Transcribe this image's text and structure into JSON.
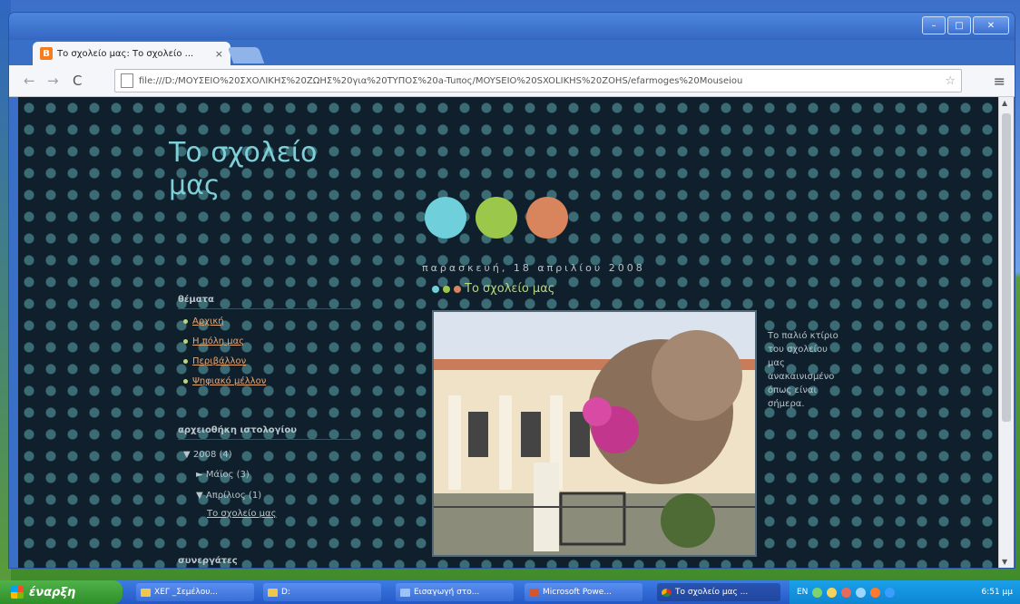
{
  "browser": {
    "tab_title": "Το σχολείο μας: Το σχολείο ...",
    "tab_favicon": "B",
    "tab_close": "×",
    "url": "file:///D:/ΜΟΥΣΕΙΟ%20ΣΧΟΛΙΚΗΣ%20ΖΩΗΣ%20για%20ΤΥΠΟΣ%20a-Tuπος/MOYSEIO%20SXOLIKHS%20ZOHS/efarmoges%20Mouseiou"
  },
  "blog": {
    "title": "Το σχολείο μας",
    "date": "παρασκευή, 18 απριλίου 2008",
    "post_title": "Το σχολείο μας",
    "post_text": "Το παλιό κτίριο του σχολείου μας ανακαινισμένο όπως είναι σήμερα.",
    "colors": {
      "teal": "#6fd0dc",
      "green": "#9bc84a",
      "orange": "#d8845c"
    }
  },
  "sidebar": {
    "nav_heading": "θέματα",
    "nav_items": [
      {
        "label": "Αρχική"
      },
      {
        "label": "Η πόλη μας"
      },
      {
        "label": "Περιβάλλον"
      },
      {
        "label": "Ψηφιακό μέλλον"
      }
    ],
    "archive_heading": "αρχειοθήκη ιστολογίου",
    "archive": {
      "year": "▼ 2008 (4)",
      "month1": "► Μάϊος (3)",
      "month2": "▼ Απρίλιος (1)",
      "post": "Το σχολείο μας"
    },
    "followers_heading": "συνεργάτες"
  },
  "taskbar": {
    "start_label": "έναρξη",
    "buttons": [
      {
        "label": "ΧΕΓ _Σεμέλου..."
      },
      {
        "label": "D:"
      },
      {
        "label": "Εισαγωγή στο..."
      },
      {
        "label": "Microsoft Powe..."
      },
      {
        "label": "Το σχολείο μας ..."
      }
    ],
    "language": "EN",
    "clock": "6:51 μμ"
  }
}
